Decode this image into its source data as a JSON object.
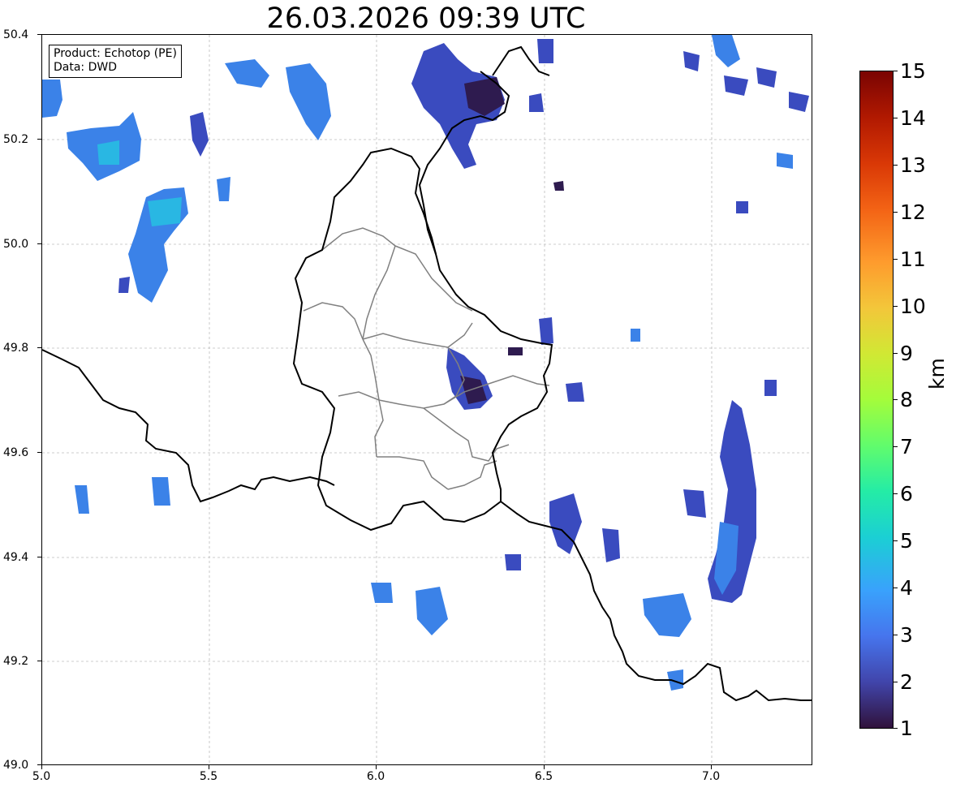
{
  "title": "26.03.2026 09:39 UTC",
  "info_box": {
    "product": "Product: Echotop (PE)",
    "data_source": "Data: DWD"
  },
  "axes": {
    "x_range": [
      5.0,
      7.3
    ],
    "y_range": [
      49.0,
      50.4
    ],
    "x_ticks": [
      "5.0",
      "5.5",
      "6.0",
      "6.5",
      "7.0"
    ],
    "y_ticks": [
      "50.4",
      "50.2",
      "50.0",
      "49.8",
      "49.6",
      "49.4",
      "49.2",
      "49.0"
    ],
    "grid": true
  },
  "colorbar": {
    "label": "km",
    "min": 1,
    "max": 15,
    "ticks": [
      "15",
      "14",
      "13",
      "12",
      "11",
      "10",
      "9",
      "8",
      "7",
      "6",
      "5",
      "4",
      "3",
      "2",
      "1"
    ],
    "colormap": "turbo"
  },
  "colors": {
    "border_line": "#000000",
    "canton_line": "#808080",
    "grid_line": "#bdbdbd",
    "echo_dark": "#2e1b4f",
    "echo_mid": "#3a4bbf",
    "echo_light": "#3b82e8",
    "echo_cyan": "#29b7e3"
  }
}
